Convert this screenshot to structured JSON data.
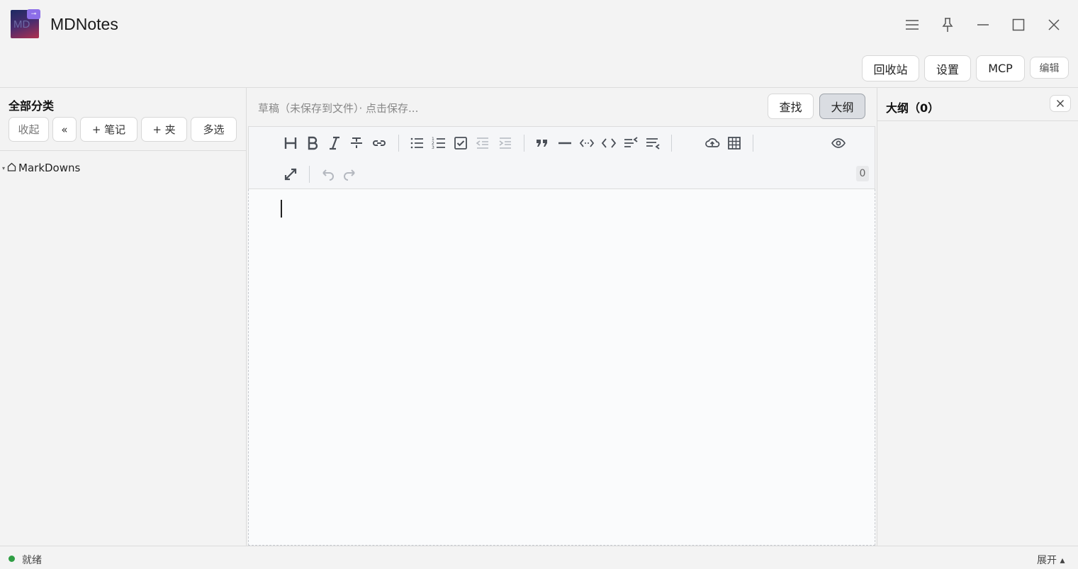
{
  "app": {
    "title": "MDNotes",
    "logo_text": "MD"
  },
  "topbar": {
    "recycle": "回收站",
    "settings": "设置",
    "mcp": "MCP",
    "edit": "编辑"
  },
  "sidebar": {
    "title": "全部分类",
    "buttons": {
      "collapse": "收起",
      "back": "«",
      "new_note": "+ 笔记",
      "new_folder": "+ 夹",
      "multi_select": "多选"
    },
    "tree": [
      {
        "label": "MarkDowns"
      }
    ]
  },
  "editor": {
    "draft_status": "草稿（未保存到文件）· 点击保存...",
    "find": "查找",
    "outline_toggle": "大纲",
    "word_count": "0"
  },
  "outline": {
    "title": "大纲（0）"
  },
  "status": {
    "text": "就绪",
    "expand": "展开 ▴"
  },
  "colors": {
    "status_ok": "#2f9e44",
    "accent": "#8c6ee8"
  }
}
